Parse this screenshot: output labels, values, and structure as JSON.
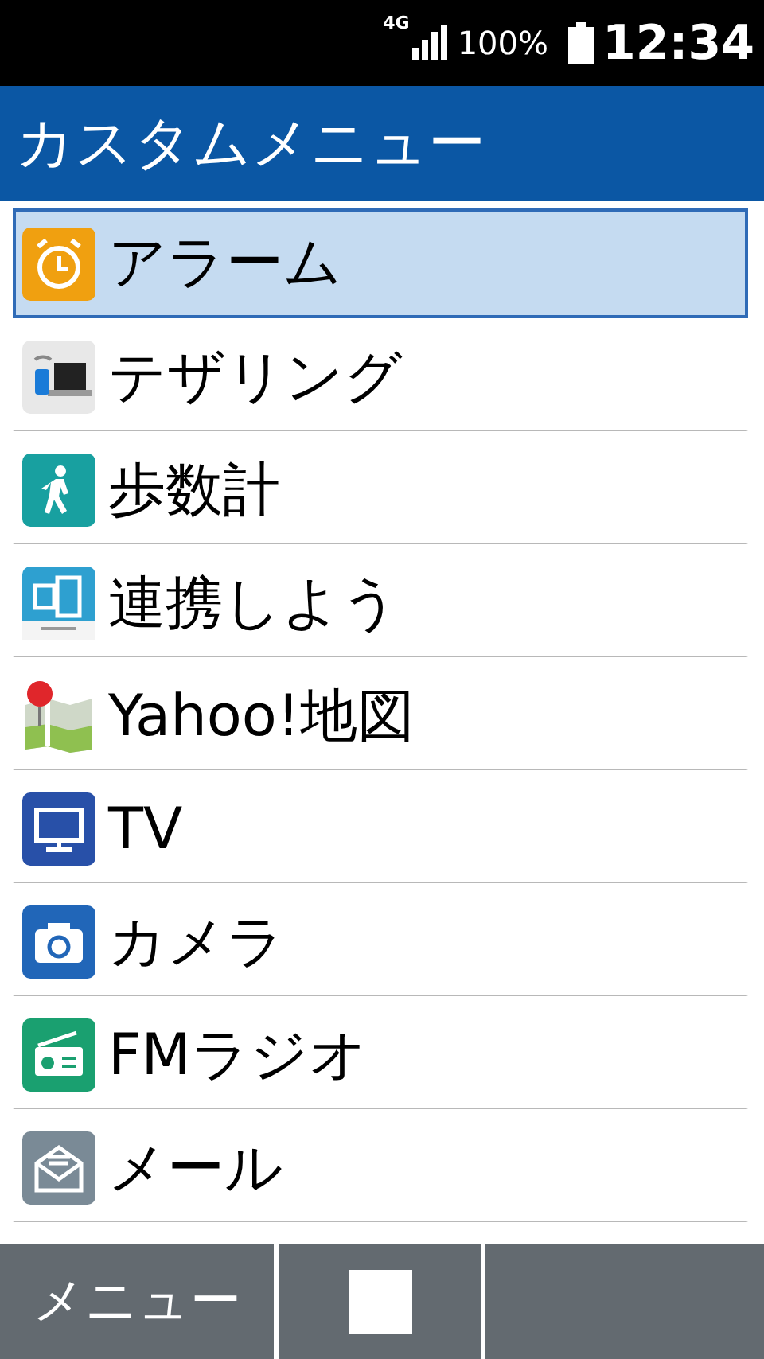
{
  "status_bar": {
    "network": "4G",
    "battery": "100%",
    "time": "12:34"
  },
  "title": "カスタムメニュー",
  "items": [
    {
      "label": "アラーム",
      "kind": "alarm",
      "selected": true
    },
    {
      "label": "テザリング",
      "kind": "tethering",
      "selected": false
    },
    {
      "label": "歩数計",
      "kind": "pedometer",
      "selected": false
    },
    {
      "label": "連携しよう",
      "kind": "link",
      "selected": false
    },
    {
      "label": "Yahoo!地図",
      "kind": "map",
      "selected": false
    },
    {
      "label": "TV",
      "kind": "tv",
      "selected": false
    },
    {
      "label": "カメラ",
      "kind": "camera",
      "selected": false
    },
    {
      "label": "FMラジオ",
      "kind": "radio",
      "selected": false
    },
    {
      "label": "メール",
      "kind": "mail",
      "selected": false
    }
  ],
  "soft_keys": [
    {
      "kind": "text",
      "label": "メニュー"
    },
    {
      "kind": "stop"
    },
    {
      "kind": "empty"
    }
  ]
}
